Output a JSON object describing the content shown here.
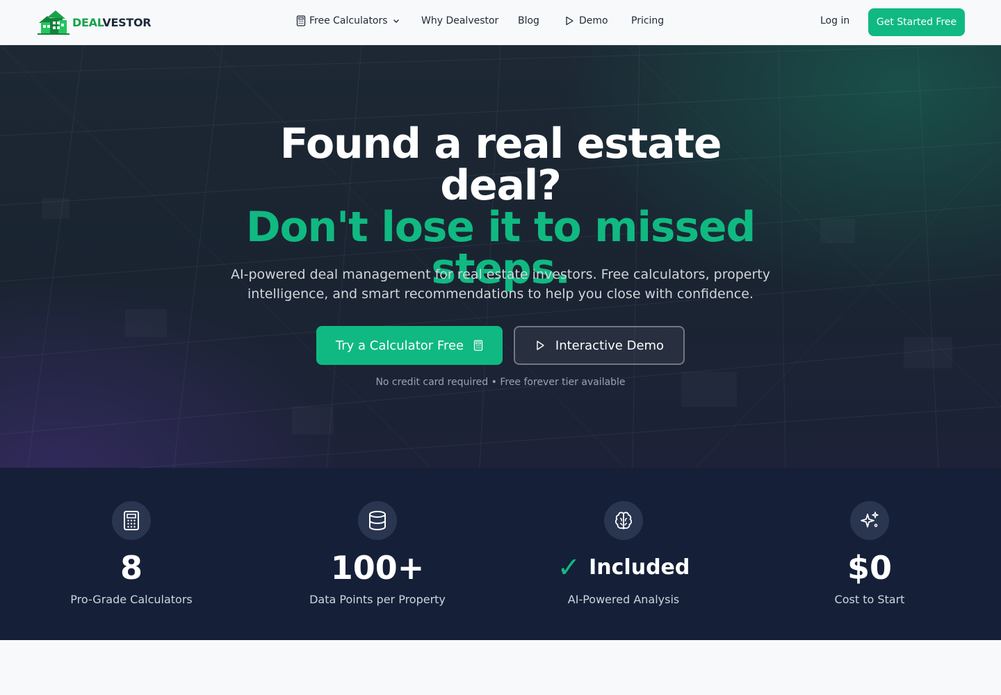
{
  "nav": {
    "logo_part1": "DEAL",
    "logo_part2": "VESTOR",
    "links": [
      {
        "label": "Free Calculators"
      },
      {
        "label": "Why Dealvestor"
      },
      {
        "label": "Blog"
      },
      {
        "label": "Demo"
      },
      {
        "label": "Pricing"
      }
    ],
    "login": "Log in",
    "cta": "Get Started Free"
  },
  "hero": {
    "title_line1": "Found a real estate deal?",
    "title_line2": "Don't lose it to missed steps.",
    "subtitle": "AI-powered deal management for real estate investors. Free calculators, property intelligence, and smart recommendations to help you close with confidence.",
    "primary_button": "Try a Calculator Free",
    "secondary_button": "Interactive Demo",
    "note": "No credit card required • Free forever tier available"
  },
  "stats": [
    {
      "icon": "calculator-icon",
      "value": "8",
      "label": "Pro-Grade Calculators"
    },
    {
      "icon": "database-icon",
      "value": "100+",
      "label": "Data Points per Property"
    },
    {
      "icon": "brain-icon",
      "check": "✓",
      "value": "Included",
      "label": "AI-Powered Analysis"
    },
    {
      "icon": "sparkles-icon",
      "value": "$0",
      "label": "Cost to Start"
    }
  ],
  "colors": {
    "accent": "#10b981",
    "hero_bg": "#1d2834",
    "stats_bg": "#152038",
    "nav_bg": "#f8f9fb"
  }
}
